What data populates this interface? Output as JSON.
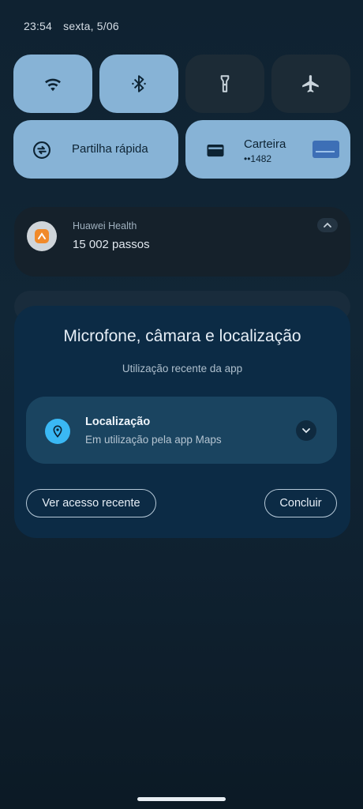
{
  "status_bar": {
    "time": "23:54",
    "date": "sexta, 5/06"
  },
  "quick_settings": {
    "tiles": [
      {
        "icon": "wifi-icon",
        "state": "on"
      },
      {
        "icon": "bluetooth-icon",
        "state": "on"
      },
      {
        "icon": "flashlight-icon",
        "state": "off"
      },
      {
        "icon": "airplane-icon",
        "state": "off"
      }
    ],
    "share_label": "Partilha rápida",
    "wallet_label": "Carteira",
    "wallet_card": "••1482"
  },
  "notification": {
    "app_name": "Huawei Health",
    "text": "15 002 passos"
  },
  "dialog": {
    "title": "Microfone, câmara e localização",
    "subtitle": "Utilização recente da app",
    "usage": {
      "permission": "Localização",
      "detail": "Em utilização pela app Maps"
    },
    "recent_access_button": "Ver acesso recente",
    "done_button": "Concluir"
  },
  "colors": {
    "tile_on": "#87b3d6",
    "tile_off": "#1c2b36",
    "dialog_bg": "#0c2b45",
    "location_accent": "#3ab8f4"
  }
}
